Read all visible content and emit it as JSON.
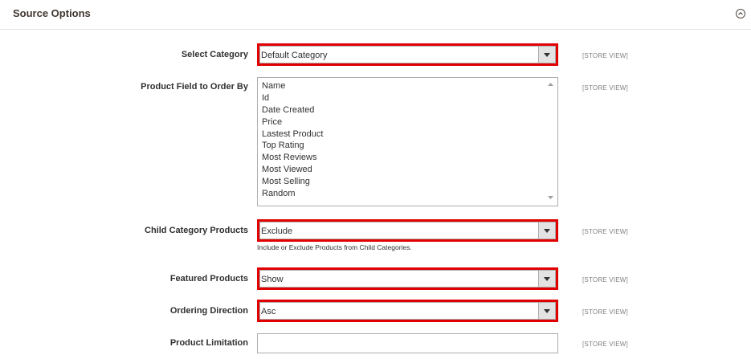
{
  "section": {
    "title": "Source Options",
    "toggle_icon": "collapse-up-circle-icon"
  },
  "fields": {
    "select_category": {
      "label": "Select Category",
      "value": "Default Category",
      "scope": "[STORE VIEW]"
    },
    "product_field_order": {
      "label": "Product Field to Order By",
      "options": [
        "Name",
        "Id",
        "Date Created",
        "Price",
        "Lastest Product",
        "Top Rating",
        "Most Reviews",
        "Most Viewed",
        "Most Selling",
        "Random"
      ],
      "scope": "[STORE VIEW]"
    },
    "child_category_products": {
      "label": "Child Category Products",
      "value": "Exclude",
      "note": "Include or Exclude Products from Child Categories.",
      "scope": "[STORE VIEW]"
    },
    "featured_products": {
      "label": "Featured Products",
      "value": "Show",
      "scope": "[STORE VIEW]"
    },
    "ordering_direction": {
      "label": "Ordering Direction",
      "value": "Asc",
      "scope": "[STORE VIEW]"
    },
    "product_limitation": {
      "label": "Product Limitation",
      "value": "",
      "scope": "[STORE VIEW]"
    }
  },
  "colors": {
    "highlight": "#e10000",
    "label": "#303030",
    "scope": "#808080"
  }
}
